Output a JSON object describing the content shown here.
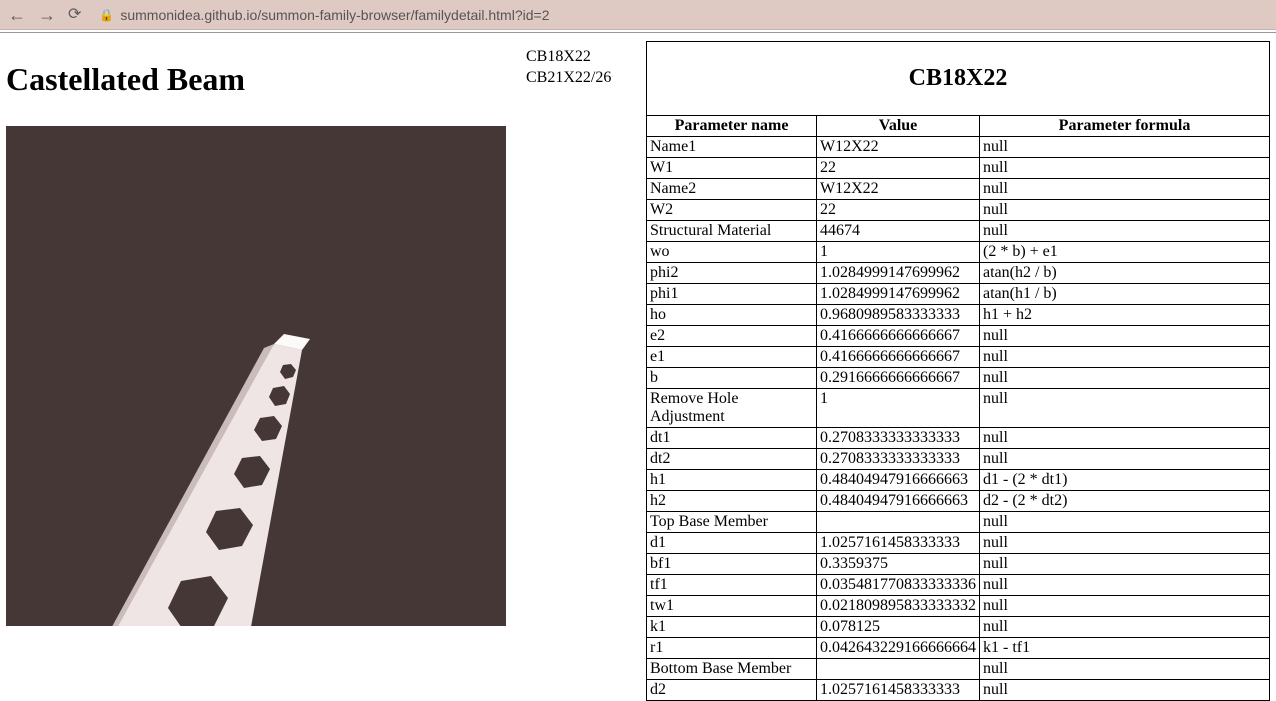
{
  "browser": {
    "url": "summonidea.github.io/summon-family-browser/familydetail.html?id=2"
  },
  "page": {
    "title": "Castellated Beam"
  },
  "types": [
    {
      "label": "CB18X22"
    },
    {
      "label": "CB21X22/26"
    }
  ],
  "detail": {
    "title": "CB18X22",
    "headers": {
      "name": "Parameter name",
      "value": "Value",
      "formula": "Parameter formula"
    },
    "rows": [
      {
        "name": "Name1",
        "value": "W12X22",
        "formula": "null"
      },
      {
        "name": "W1",
        "value": "22",
        "formula": "null"
      },
      {
        "name": "Name2",
        "value": "W12X22",
        "formula": "null"
      },
      {
        "name": "W2",
        "value": "22",
        "formula": "null"
      },
      {
        "name": "Structural Material",
        "value": "44674",
        "formula": "null"
      },
      {
        "name": "wo",
        "value": "1",
        "formula": "(2 * b) + e1"
      },
      {
        "name": "phi2",
        "value": "1.0284999147699962",
        "formula": "atan(h2 / b)"
      },
      {
        "name": "phi1",
        "value": "1.0284999147699962",
        "formula": "atan(h1 / b)"
      },
      {
        "name": "ho",
        "value": "0.9680989583333333",
        "formula": "h1 + h2"
      },
      {
        "name": "e2",
        "value": "0.4166666666666667",
        "formula": "null"
      },
      {
        "name": "e1",
        "value": "0.4166666666666667",
        "formula": "null"
      },
      {
        "name": "b",
        "value": "0.2916666666666667",
        "formula": "null"
      },
      {
        "name": "Remove Hole Adjustment",
        "value": "1",
        "formula": "null"
      },
      {
        "name": "dt1",
        "value": "0.2708333333333333",
        "formula": "null"
      },
      {
        "name": "dt2",
        "value": "0.2708333333333333",
        "formula": "null"
      },
      {
        "name": "h1",
        "value": "0.48404947916666663",
        "formula": "d1 - (2 * dt1)"
      },
      {
        "name": "h2",
        "value": "0.48404947916666663",
        "formula": "d2 - (2 * dt2)"
      },
      {
        "name": "Top Base Member",
        "value": "",
        "formula": "null"
      },
      {
        "name": "d1",
        "value": "1.0257161458333333",
        "formula": "null"
      },
      {
        "name": "bf1",
        "value": "0.3359375",
        "formula": "null"
      },
      {
        "name": "tf1",
        "value": "0.035481770833333336",
        "formula": "null"
      },
      {
        "name": "tw1",
        "value": "0.021809895833333332",
        "formula": "null"
      },
      {
        "name": "k1",
        "value": "0.078125",
        "formula": "null"
      },
      {
        "name": "r1",
        "value": "0.042643229166666664",
        "formula": "k1 - tf1"
      },
      {
        "name": "Bottom Base Member",
        "value": "",
        "formula": "null"
      },
      {
        "name": "d2",
        "value": "1.0257161458333333",
        "formula": "null"
      }
    ]
  }
}
